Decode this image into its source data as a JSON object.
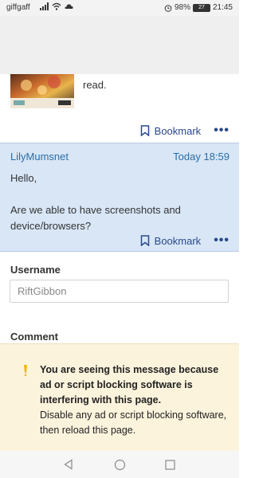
{
  "status_bar": {
    "carrier": "giffgaff",
    "battery": "98%",
    "battery_level": "27",
    "time": "21:45"
  },
  "post1": {
    "text_fragment": "read.",
    "bookmark_label": "Bookmark"
  },
  "post2": {
    "author": "LilyMumsnet",
    "time": "Today 18:59",
    "line1": "Hello,",
    "line2": "Are we able to have screenshots and device/browsers?",
    "bookmark_label": "Bookmark"
  },
  "form": {
    "username_label": "Username",
    "username_value": "RiftGibbon",
    "comment_label": "Comment"
  },
  "ad_banner": {
    "bold_text": "You are seeing this message because ad or script blocking software is interfering with this page.",
    "normal_text": "Disable any ad or script blocking software, then reload this page."
  },
  "colors": {
    "accent": "#2a6ea8",
    "highlight_bg": "#d8e6f6",
    "banner_bg": "#fbf3dc",
    "warning": "#f2b705"
  },
  "icons": [
    "alarm-icon",
    "signal-icon",
    "wifi-icon",
    "bookmark-icon",
    "more-icon",
    "warning-icon",
    "back-icon",
    "home-icon",
    "recents-icon"
  ]
}
